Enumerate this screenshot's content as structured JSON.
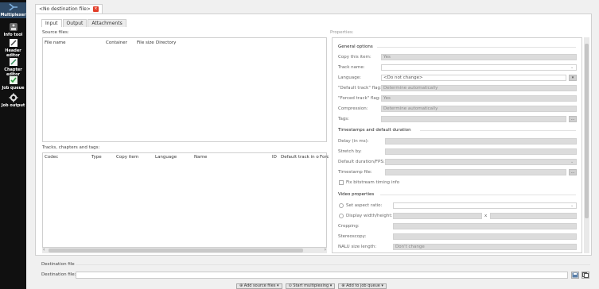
{
  "sidebar": {
    "logo_label": "Multiplexer",
    "items": [
      {
        "label": "Info tool",
        "icon": "info-tool-icon"
      },
      {
        "label": "Header editor",
        "icon": "header-editor-icon"
      },
      {
        "label": "Chapter editor",
        "icon": "chapter-editor-icon"
      },
      {
        "label": "Job queue",
        "icon": "job-queue-icon"
      },
      {
        "label": "Job output",
        "icon": "job-output-icon"
      }
    ]
  },
  "document_tab": {
    "label": "<No destination file>",
    "close": "×"
  },
  "tabs": [
    "Input",
    "Output",
    "Attachments"
  ],
  "source_files": {
    "title": "Source files:",
    "columns": [
      "File name",
      "Container",
      "File size",
      "Directory"
    ]
  },
  "tracks": {
    "title": "Tracks, chapters and tags:",
    "columns": [
      "Codec",
      "Type",
      "Copy item",
      "Language",
      "Name",
      "ID",
      "Default track in o",
      "Forc"
    ]
  },
  "properties": {
    "title": "Properties:",
    "general": {
      "title": "General options",
      "rows": [
        {
          "label": "Copy this item:",
          "value": "Yes"
        },
        {
          "label": "Track name:",
          "value": ""
        },
        {
          "label": "Language:",
          "value": "<Do not change>"
        },
        {
          "label": "\"Default track\" flag:",
          "value": "Determine automatically"
        },
        {
          "label": "\"Forced track\" flag:",
          "value": "Yes"
        },
        {
          "label": "Compression:",
          "value": "Determine automatically"
        },
        {
          "label": "Tags:",
          "value": ""
        }
      ]
    },
    "timestamps": {
      "title": "Timestamps and default duration",
      "rows": [
        {
          "label": "Delay (in ms):",
          "value": ""
        },
        {
          "label": "Stretch by:",
          "value": ""
        },
        {
          "label": "Default duration/FPS:",
          "value": ""
        },
        {
          "label": "Timestamp file:",
          "value": ""
        }
      ],
      "fix_bitstream": "Fix bitstream timing info"
    },
    "video": {
      "title": "Video properties",
      "aspect_ratio": "Set aspect ratio:",
      "display_wh": "Display width/height:",
      "x_sep": "x",
      "cropping": "Cropping:",
      "stereoscopy": "Stereoscopy:",
      "nalu": "NALU size length:",
      "nalu_value": "Don't change"
    }
  },
  "destination": {
    "group_title": "Destination file",
    "label": "Destination file:",
    "value": ""
  },
  "bottom_buttons": [
    "Add source files",
    "Start multiplexing",
    "Add to job queue"
  ]
}
